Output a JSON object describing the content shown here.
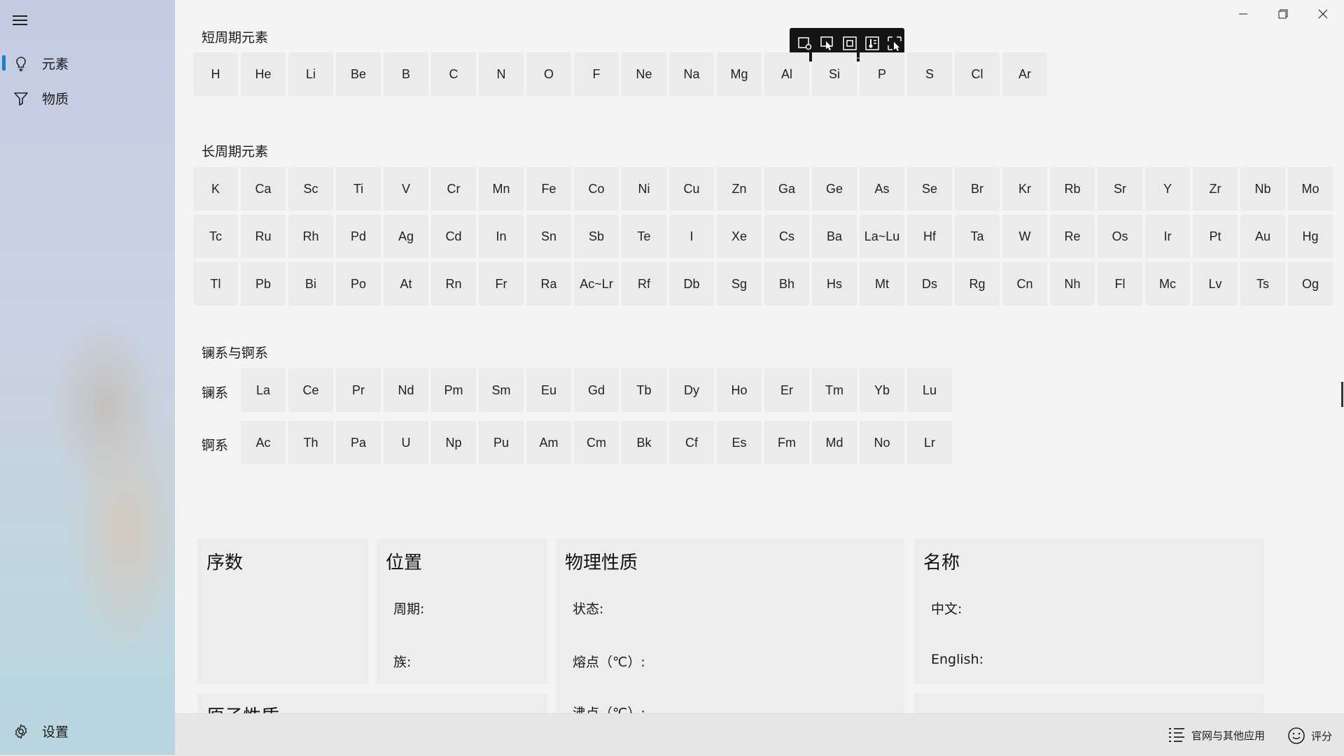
{
  "nav": {
    "items": [
      {
        "label": "元素",
        "icon": "lightbulb-icon"
      },
      {
        "label": "物质",
        "icon": "filter-icon"
      }
    ],
    "settings_label": "设置"
  },
  "sections": {
    "short_period": {
      "title": "短周期元素",
      "rows": [
        [
          "H",
          "He",
          "Li",
          "Be",
          "B",
          "C",
          "N",
          "O",
          "F",
          "Ne",
          "Na",
          "Mg",
          "Al",
          "Si",
          "P",
          "S",
          "Cl",
          "Ar"
        ]
      ]
    },
    "long_period": {
      "title": "长周期元素",
      "rows": [
        [
          "K",
          "Ca",
          "Sc",
          "Ti",
          "V",
          "Cr",
          "Mn",
          "Fe",
          "Co",
          "Ni",
          "Cu",
          "Zn",
          "Ga",
          "Ge",
          "As",
          "Se",
          "Br",
          "Kr",
          "Rb",
          "Sr",
          "Y",
          "Zr",
          "Nb",
          "Mo"
        ],
        [
          "Tc",
          "Ru",
          "Rh",
          "Pd",
          "Ag",
          "Cd",
          "In",
          "Sn",
          "Sb",
          "Te",
          "I",
          "Xe",
          "Cs",
          "Ba",
          "La~Lu",
          "Hf",
          "Ta",
          "W",
          "Re",
          "Os",
          "Ir",
          "Pt",
          "Au",
          "Hg"
        ],
        [
          "Tl",
          "Pb",
          "Bi",
          "Po",
          "At",
          "Rn",
          "Fr",
          "Ra",
          "Ac~Lr",
          "Rf",
          "Db",
          "Sg",
          "Bh",
          "Hs",
          "Mt",
          "Ds",
          "Rg",
          "Cn",
          "Nh",
          "Fl",
          "Mc",
          "Lv",
          "Ts",
          "Og"
        ]
      ]
    },
    "f_block": {
      "title": "镧系与锕系",
      "lanthanide_label": "镧系",
      "actinide_label": "锕系",
      "lanthanides": [
        "La",
        "Ce",
        "Pr",
        "Nd",
        "Pm",
        "Sm",
        "Eu",
        "Gd",
        "Tb",
        "Dy",
        "Ho",
        "Er",
        "Tm",
        "Yb",
        "Lu"
      ],
      "actinides": [
        "Ac",
        "Th",
        "Pa",
        "U",
        "Np",
        "Pu",
        "Am",
        "Cm",
        "Bk",
        "Cf",
        "Es",
        "Fm",
        "Md",
        "No",
        "Lr"
      ]
    }
  },
  "cards": {
    "ordinal": {
      "title": "序数"
    },
    "position": {
      "title": "位置",
      "period_label": "周期:",
      "group_label": "族:"
    },
    "physical": {
      "title": "物理性质",
      "state_label": "状态:",
      "melting_label": "熔点（℃）:",
      "boiling_label": "沸点（℃）:"
    },
    "name": {
      "title": "名称",
      "chinese_label": "中文:",
      "english_label": "English:"
    },
    "atomic": {
      "title": "原子性质"
    }
  },
  "bottom": {
    "website_label": "官网与其他应用",
    "rate_label": "评分"
  }
}
